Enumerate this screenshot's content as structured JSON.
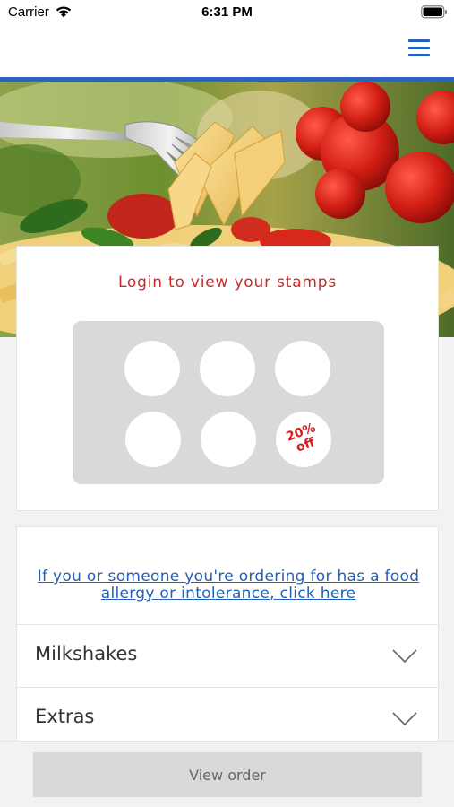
{
  "status_bar": {
    "carrier": "Carrier",
    "time": "6:31 PM",
    "icons": [
      "wifi-icon",
      "battery-icon"
    ]
  },
  "header": {
    "menu_icon": "hamburger-menu-icon",
    "accent_color": "#2e63b8"
  },
  "hero": {
    "image": "pasta-on-fork-with-tomatoes-photo"
  },
  "stamp_card": {
    "title": "Login to view your stamps",
    "title_color": "#c62a2a",
    "stamps_total": 6,
    "reward": {
      "line1": "20%",
      "line2": "off",
      "color": "#d41d1d"
    }
  },
  "menu": {
    "allergy_link": "If you or someone you're ordering for has a food allergy or intolerance, click here",
    "link_color": "#2460b8",
    "categories": [
      {
        "label": "Milkshakes",
        "icon": "chevron-down-icon"
      },
      {
        "label": "Extras",
        "icon": "chevron-down-icon"
      }
    ]
  },
  "footer": {
    "view_order_label": "View order"
  }
}
